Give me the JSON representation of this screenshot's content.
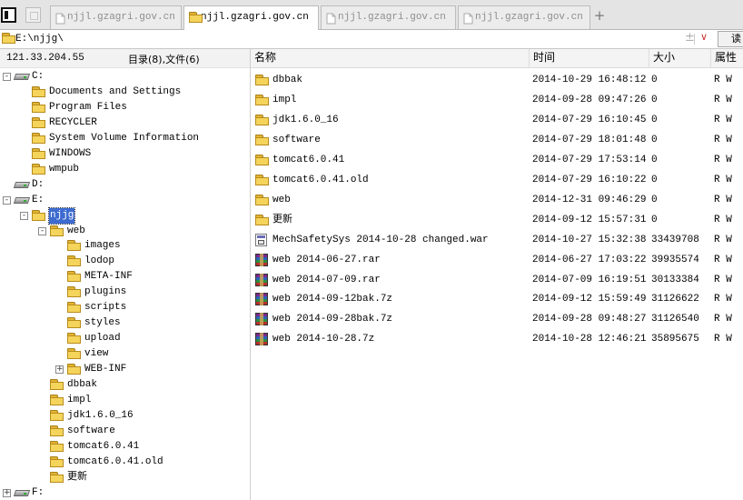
{
  "tabs": [
    {
      "label": "njjl.gzagri.gov.cn",
      "active": false
    },
    {
      "label": "njjl.gzagri.gov.cn",
      "active": true
    },
    {
      "label": "njjl.gzagri.gov.cn",
      "active": false
    },
    {
      "label": "njjl.gzagri.gov.cn",
      "active": false
    }
  ],
  "new_tab_label": "+",
  "address": {
    "path": "E:\\njjg\\",
    "plus_glyph": "±",
    "dropdown_glyph": "∨",
    "read_button": "读"
  },
  "left": {
    "server": "121.33.204.55",
    "dir_count": "目录(8),文件(6)",
    "tree": [
      {
        "label": "C:",
        "icon": "drive",
        "level": 0,
        "expander": "-"
      },
      {
        "label": "Documents and Settings",
        "icon": "folder",
        "level": 1
      },
      {
        "label": "Program Files",
        "icon": "folder",
        "level": 1
      },
      {
        "label": "RECYCLER",
        "icon": "folder",
        "level": 1
      },
      {
        "label": "System Volume Information",
        "icon": "folder",
        "level": 1
      },
      {
        "label": "WINDOWS",
        "icon": "folder",
        "level": 1
      },
      {
        "label": "wmpub",
        "icon": "folder",
        "level": 1
      },
      {
        "label": "D:",
        "icon": "drive",
        "level": 0
      },
      {
        "label": "E:",
        "icon": "drive",
        "level": 0,
        "expander": "-"
      },
      {
        "label": "njjg",
        "icon": "folder",
        "level": 1,
        "expander": "-",
        "selected": true
      },
      {
        "label": "web",
        "icon": "folder",
        "level": 2,
        "expander": "-"
      },
      {
        "label": "images",
        "icon": "folder",
        "level": 3
      },
      {
        "label": "lodop",
        "icon": "folder",
        "level": 3
      },
      {
        "label": "META-INF",
        "icon": "folder",
        "level": 3
      },
      {
        "label": "plugins",
        "icon": "folder",
        "level": 3
      },
      {
        "label": "scripts",
        "icon": "folder",
        "level": 3
      },
      {
        "label": "styles",
        "icon": "folder",
        "level": 3
      },
      {
        "label": "upload",
        "icon": "folder",
        "level": 3
      },
      {
        "label": "view",
        "icon": "folder",
        "level": 3
      },
      {
        "label": "WEB-INF",
        "icon": "folder",
        "level": 3,
        "expander": "+"
      },
      {
        "label": "dbbak",
        "icon": "folder",
        "level": 2
      },
      {
        "label": "impl",
        "icon": "folder",
        "level": 2
      },
      {
        "label": "jdk1.6.0_16",
        "icon": "folder",
        "level": 2
      },
      {
        "label": "software",
        "icon": "folder",
        "level": 2
      },
      {
        "label": "tomcat6.0.41",
        "icon": "folder",
        "level": 2
      },
      {
        "label": "tomcat6.0.41.old",
        "icon": "folder",
        "level": 2
      },
      {
        "label": "更新",
        "icon": "folder",
        "level": 2
      },
      {
        "label": "F:",
        "icon": "drive",
        "level": 0,
        "expander": "+"
      }
    ]
  },
  "list": {
    "headers": {
      "name": "名称",
      "time": "时间",
      "size": "大小",
      "attr": "属性"
    },
    "rows": [
      {
        "name": "dbbak",
        "time": "2014-10-29 16:48:12",
        "size": "0",
        "attr": "R W",
        "icon": "folder"
      },
      {
        "name": "impl",
        "time": "2014-09-28 09:47:26",
        "size": "0",
        "attr": "R W",
        "icon": "folder"
      },
      {
        "name": "jdk1.6.0_16",
        "time": "2014-07-29 16:10:45",
        "size": "0",
        "attr": "R W",
        "icon": "folder"
      },
      {
        "name": "software",
        "time": "2014-07-29 18:01:48",
        "size": "0",
        "attr": "R W",
        "icon": "folder"
      },
      {
        "name": "tomcat6.0.41",
        "time": "2014-07-29 17:53:14",
        "size": "0",
        "attr": "R W",
        "icon": "folder"
      },
      {
        "name": "tomcat6.0.41.old",
        "time": "2014-07-29 16:10:22",
        "size": "0",
        "attr": "R W",
        "icon": "folder"
      },
      {
        "name": "web",
        "time": "2014-12-31 09:46:29",
        "size": "0",
        "attr": "R W",
        "icon": "folder"
      },
      {
        "name": "更新",
        "time": "2014-09-12 15:57:31",
        "size": "0",
        "attr": "R W",
        "icon": "folder"
      },
      {
        "name": "MechSafetySys 2014-10-28 changed.war",
        "time": "2014-10-27 15:32:38",
        "size": "33439708",
        "attr": "R W",
        "icon": "war"
      },
      {
        "name": "web 2014-06-27.rar",
        "time": "2014-06-27 17:03:22",
        "size": "39935574",
        "attr": "R W",
        "icon": "winrar"
      },
      {
        "name": "web 2014-07-09.rar",
        "time": "2014-07-09 16:19:51",
        "size": "30133384",
        "attr": "R W",
        "icon": "winrar"
      },
      {
        "name": "web 2014-09-12bak.7z",
        "time": "2014-09-12 15:59:49",
        "size": "31126622",
        "attr": "R W",
        "icon": "winrar"
      },
      {
        "name": "web 2014-09-28bak.7z",
        "time": "2014-09-28 09:48:27",
        "size": "31126540",
        "attr": "R W",
        "icon": "winrar"
      },
      {
        "name": "web 2014-10-28.7z",
        "time": "2014-10-28 12:46:21",
        "size": "35895675",
        "attr": "R W",
        "icon": "winrar"
      }
    ]
  }
}
